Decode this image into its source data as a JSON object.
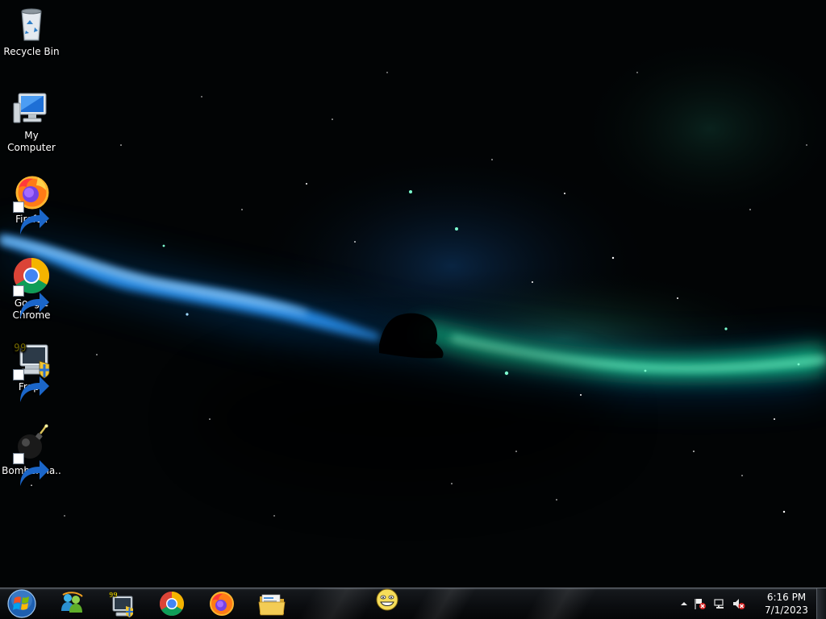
{
  "desktop": {
    "icons": [
      {
        "label": "Recycle Bin",
        "icon": "recycle-bin-icon"
      },
      {
        "label": "My Computer",
        "icon": "computer-icon"
      },
      {
        "label": "Firefox",
        "icon": "firefox-icon"
      },
      {
        "label": "Google Chrome",
        "icon": "chrome-icon"
      },
      {
        "label": "Fraps",
        "icon": "fraps-icon",
        "badge": "99"
      },
      {
        "label": "Bomberma...",
        "icon": "bomb-icon"
      }
    ]
  },
  "taskbar": {
    "start_icon": "windows-orb-icon",
    "pinned": [
      {
        "name": "Windows Live Messenger",
        "icon": "messenger-icon"
      },
      {
        "name": "Fraps",
        "icon": "fraps-icon",
        "badge": "99"
      },
      {
        "name": "Google Chrome",
        "icon": "chrome-icon"
      },
      {
        "name": "Firefox",
        "icon": "firefox-icon"
      },
      {
        "name": "Windows Explorer",
        "icon": "folder-icon"
      },
      {
        "name": "Smiley",
        "icon": "smiley-icon"
      }
    ]
  },
  "tray": {
    "icons": [
      "chevron-up-icon",
      "action-center-flag-icon",
      "network-icon",
      "volume-muted-icon"
    ],
    "time": "6:16 PM",
    "date": "7/1/2023"
  },
  "colors": {
    "nebula_green": "#22e8a0",
    "nebula_blue": "#1a7fff",
    "taskbar": "#0b0d10"
  }
}
